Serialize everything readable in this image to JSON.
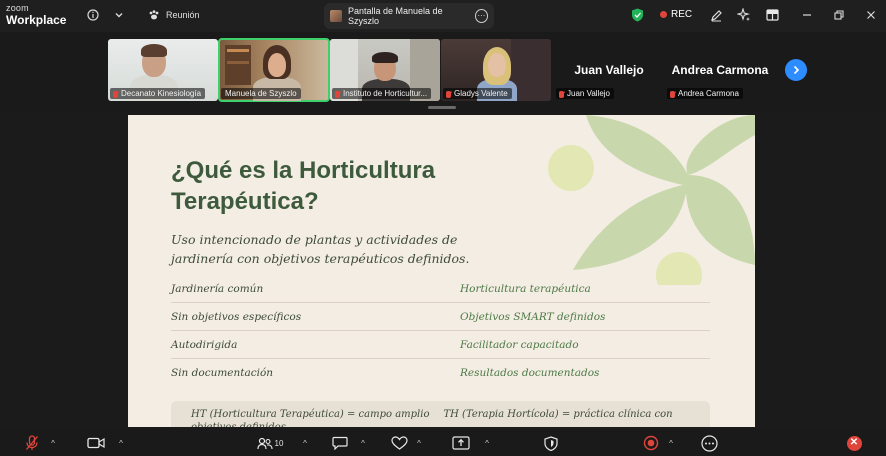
{
  "app": {
    "logo_line1": "zoom",
    "logo_line2": "Workplace",
    "meeting_label": "Reunión",
    "share_label": "Pantalla de Manuela de Szyszlo",
    "share_more_icon": "⋯",
    "rec_label": "REC",
    "colors": {
      "accent_green": "#3ed16b",
      "rec_red": "#e0453b",
      "blue": "#2d8cff"
    }
  },
  "participants": [
    {
      "name": "Decanato Kinesiología",
      "muted": true,
      "active": false
    },
    {
      "name": "Manuela de Szyszlo",
      "muted": false,
      "active": true
    },
    {
      "name": "Instituto de Horticultur...",
      "muted": true,
      "active": false
    },
    {
      "name": "Gladys Valente",
      "muted": true,
      "active": false
    },
    {
      "display_name": "Juan Vallejo",
      "name": "Juan Vallejo",
      "muted": true,
      "active": false
    },
    {
      "display_name": "Andrea Carmona",
      "name": "Andrea Carmona",
      "muted": true,
      "active": false
    }
  ],
  "slide": {
    "title": "¿Qué es la Horticultura Terapéutica?",
    "subtitle": "Uso intencionado de plantas y actividades de jardinería con objetivos terapéuticos definidos.",
    "rows": [
      {
        "left": "Jardinería común",
        "right": "Horticultura terapéutica"
      },
      {
        "left": "Sin objetivos específicos",
        "right": "Objetivos SMART definidos"
      },
      {
        "left": "Autodirigida",
        "right": "Facilitador capacitado"
      },
      {
        "left": "Sin documentación",
        "right": "Resultados documentados"
      }
    ],
    "note_a": "HT (Horticultura Terapéutica) = campo amplio",
    "note_b": "TH (Terapia Hortícola) = práctica clínica con objetivos definidos"
  },
  "toolbar": {
    "participants_count": "10"
  }
}
